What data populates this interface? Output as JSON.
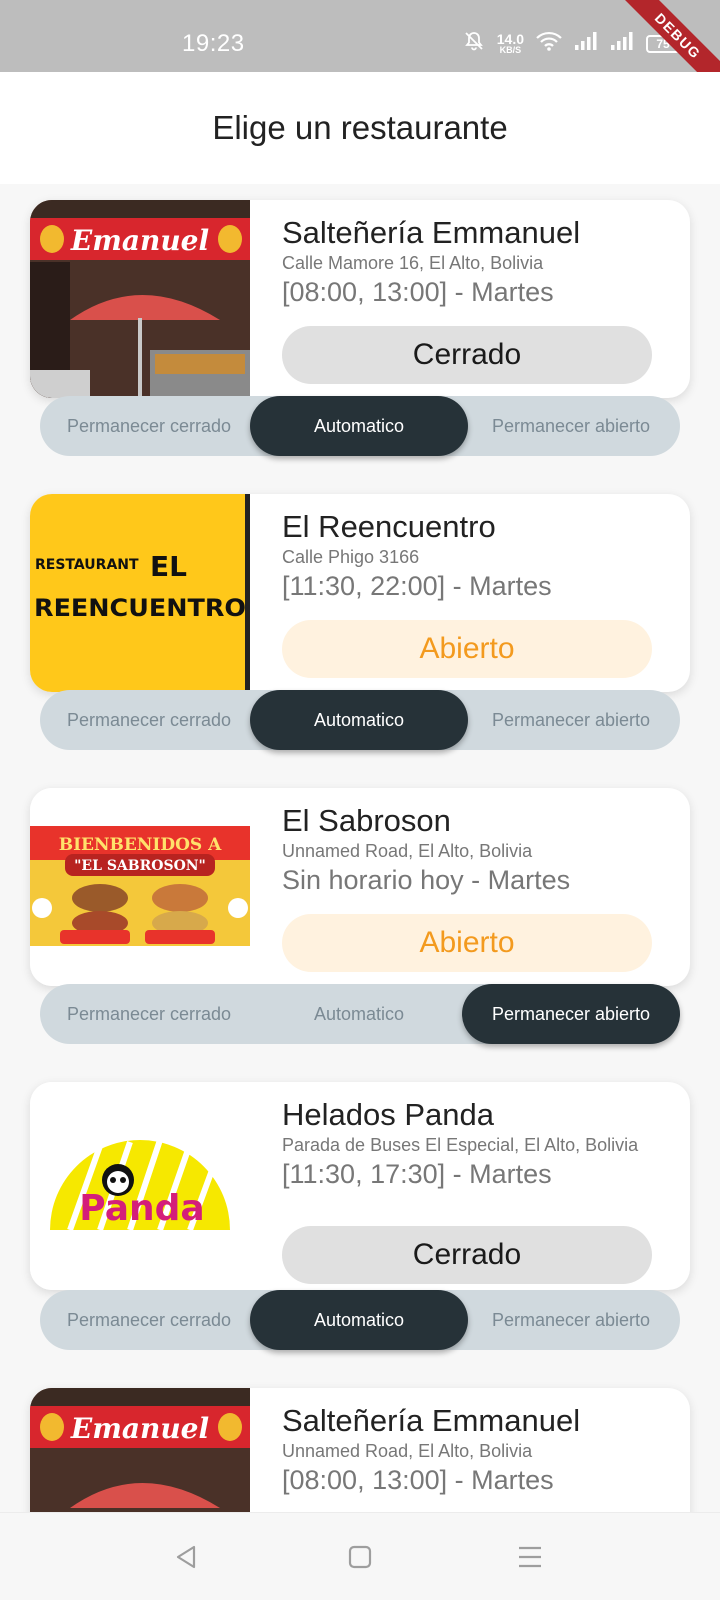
{
  "status_bar": {
    "time": "19:23",
    "net_speed": "14.0",
    "net_unit": "KB/S",
    "battery": "75",
    "debug_banner": "DEBUG"
  },
  "header": {
    "title": "Elige un restaurante"
  },
  "toggle_labels": {
    "closed": "Permanecer cerrado",
    "auto": "Automatico",
    "open": "Permanecer abierto"
  },
  "restaurants": [
    {
      "name": "Salteñería Emmanuel",
      "address": "Calle Mamore 16, El Alto, Bolivia",
      "hours": "[08:00, 13:00] - Martes",
      "status": "Cerrado",
      "mode": "Automatico",
      "image_text": "Emanuel"
    },
    {
      "name": "El Reencuentro",
      "address": "Calle Phigo 3166",
      "hours": "[11:30, 22:00] - Martes",
      "status": "Abierto",
      "mode": "Automatico",
      "image_text_1": "RESTAURANT",
      "image_text_2": "EL",
      "image_text_3": "REENCUENTRO"
    },
    {
      "name": "El Sabroson",
      "address": "Unnamed Road, El Alto, Bolivia",
      "hours": "Sin horario hoy - Martes",
      "status": "Abierto",
      "mode": "Permanecer abierto",
      "image_text_1": "BIENBENIDOS A",
      "image_text_2": "\"EL SABROSON\""
    },
    {
      "name": "Helados Panda",
      "address": "Parada de Buses El Especial, El Alto, Bolivia",
      "hours": "[11:30, 17:30] - Martes",
      "status": "Cerrado",
      "mode": "Automatico",
      "image_text": "Panda"
    },
    {
      "name": "Salteñería Emmanuel",
      "address": "Unnamed Road, El Alto, Bolivia",
      "hours": "[08:00, 13:00] - Martes",
      "image_text": "Emanuel"
    }
  ],
  "colors": {
    "accent_dark": "#263238",
    "open_text": "#f39a1e",
    "open_bg": "#fff2df",
    "closed_bg": "#e0e0e0",
    "toggle_bg": "#d0d9de"
  },
  "nav": {
    "back": "back-icon",
    "home": "home-icon",
    "recents": "menu-icon"
  }
}
